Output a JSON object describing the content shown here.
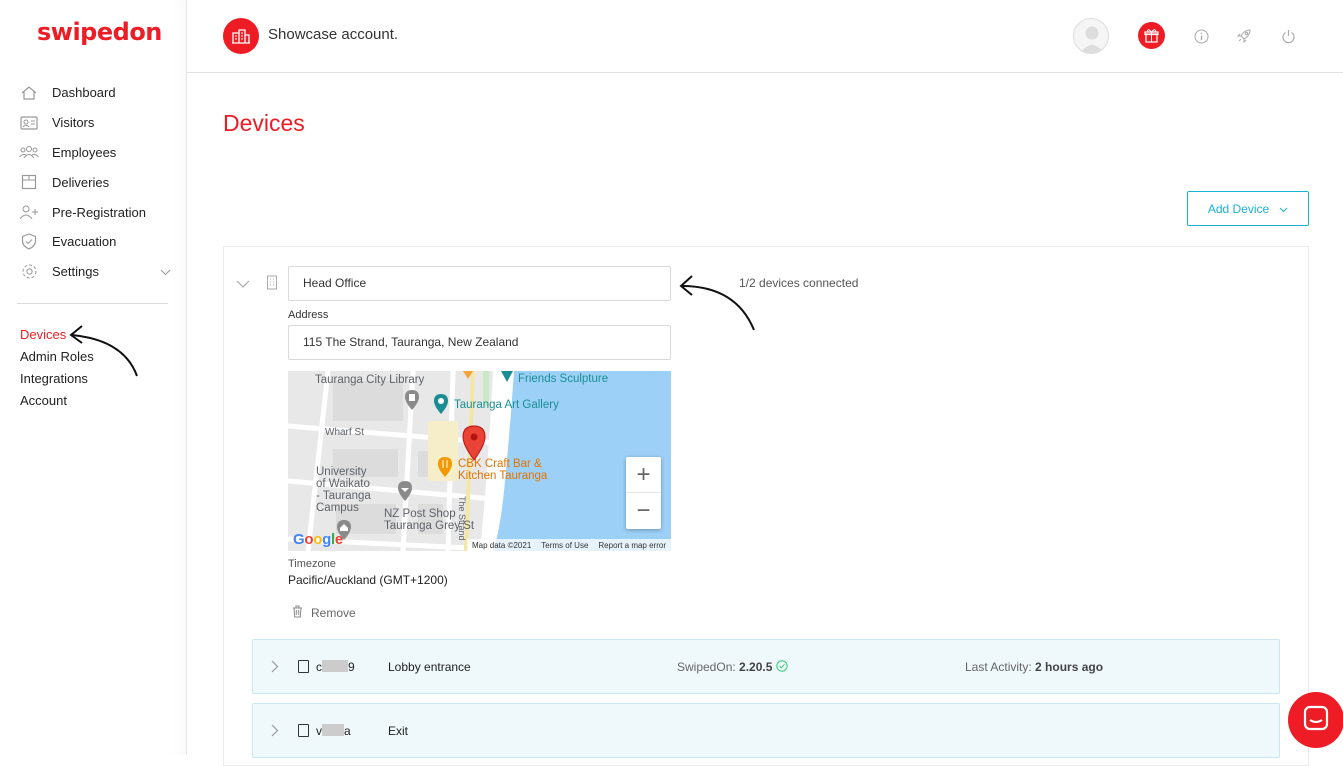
{
  "app": {
    "logo_text": "swipedon",
    "brand_color": "#ee1c25",
    "accent_color": "#19b3d1",
    "account_name": "Showcase account."
  },
  "sidebar": {
    "items": [
      {
        "label": "Dashboard",
        "icon": "home-icon"
      },
      {
        "label": "Visitors",
        "icon": "id-card-icon"
      },
      {
        "label": "Employees",
        "icon": "people-icon"
      },
      {
        "label": "Deliveries",
        "icon": "box-icon"
      },
      {
        "label": "Pre-Registration",
        "icon": "add-user-icon"
      },
      {
        "label": "Evacuation",
        "icon": "shield-icon"
      },
      {
        "label": "Settings",
        "icon": "gear-icon"
      }
    ],
    "subitems": [
      {
        "label": "Devices",
        "active": true
      },
      {
        "label": "Admin Roles"
      },
      {
        "label": "Integrations"
      },
      {
        "label": "Account"
      }
    ]
  },
  "topbar": {
    "icons": [
      "avatar",
      "gift-icon",
      "info-icon",
      "rocket-icon",
      "power-icon"
    ]
  },
  "main": {
    "title": "Devices",
    "add_device_label": "Add Device"
  },
  "location": {
    "name_value": "Head Office",
    "devices_connected": "1/2 devices connected",
    "address_label": "Address",
    "address_value": "115 The Strand, Tauranga, New Zealand",
    "timezone_label": "Timezone",
    "timezone_value": "Pacific/Auckland (GMT+1200)",
    "remove_label": "Remove"
  },
  "map": {
    "labels": {
      "library": "Tauranga City Library",
      "sculpture": "Friends Sculpture",
      "gallery": "Tauranga Art Gallery",
      "wharf": "Wharf St",
      "university": "University\nof Waikato\n- Tauranga\nCampus",
      "cbk": "CBK Craft Bar &\nKitchen Tauranga",
      "postshop": "NZ Post Shop\nTauranga Grey St",
      "strand": "The Strand"
    },
    "zoom_in": "+",
    "zoom_out": "−",
    "google_logo": "Google",
    "map_data": "Map data ©2021",
    "terms": "Terms of Use",
    "report": "Report a map error"
  },
  "devices": [
    {
      "name_start": "c",
      "name_end": "9",
      "label": "Lobby entrance",
      "version_label": "SwipedOn:",
      "version": "2.20.5",
      "activity_label": "Last Activity:",
      "activity": "2 hours ago"
    },
    {
      "name_start": "v",
      "name_end": "a",
      "label": "Exit"
    }
  ]
}
